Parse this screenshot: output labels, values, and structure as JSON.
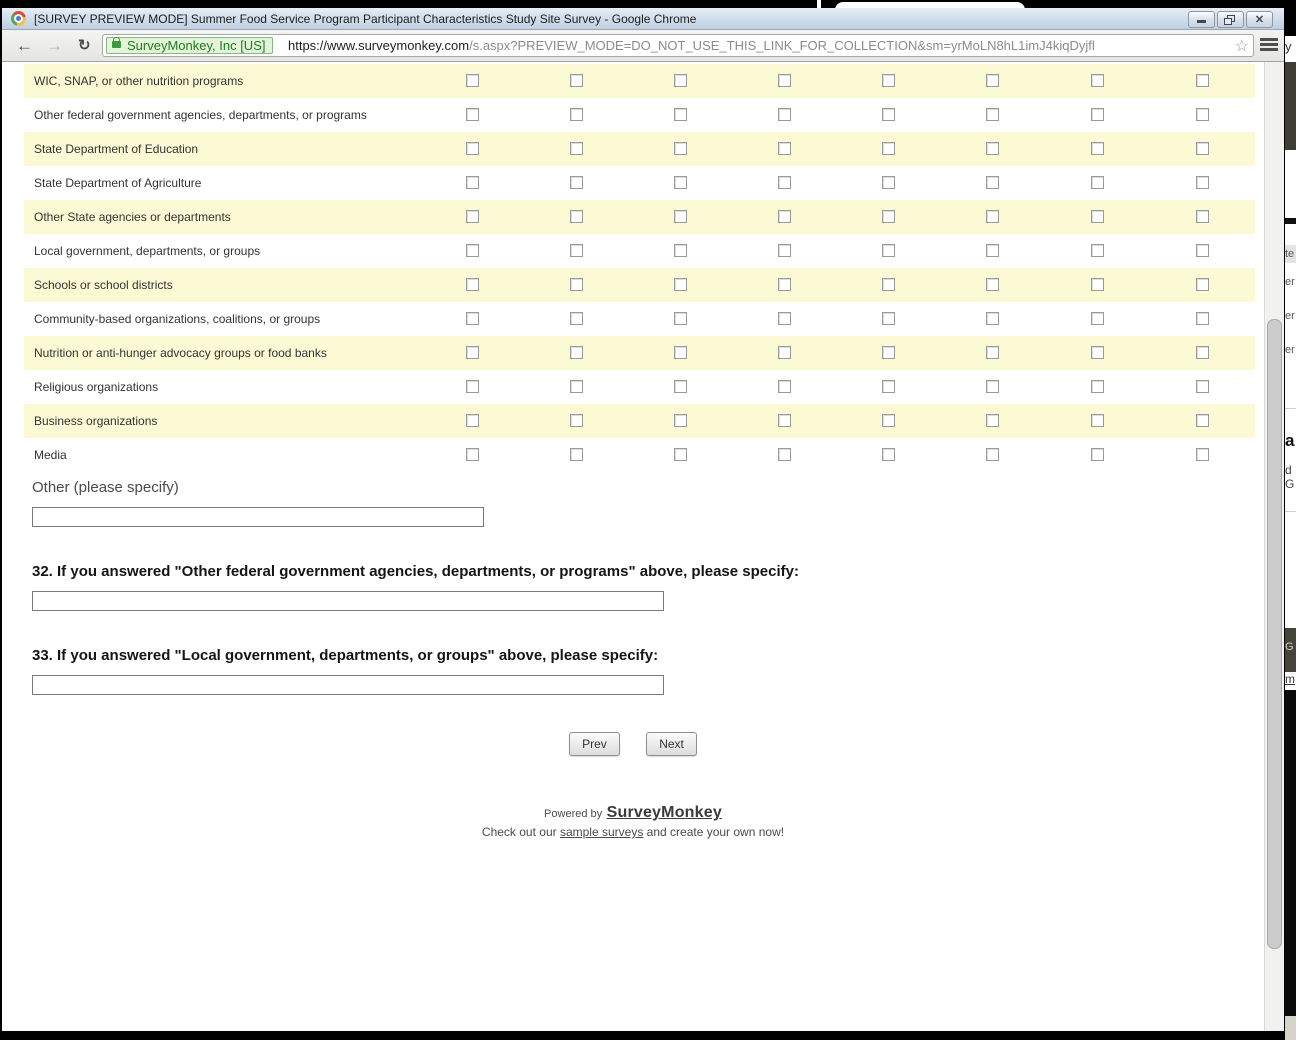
{
  "window": {
    "title": "[SURVEY PREVIEW MODE] Summer Food Service Program Participant Characteristics Study Site Survey - Google Chrome"
  },
  "browser": {
    "badge": "SurveyMonkey, Inc [US]",
    "url_host": "https://www.surveymonkey.com",
    "url_rest": "/s.aspx?PREVIEW_MODE=DO_NOT_USE_THIS_LINK_FOR_COLLECTION&sm=yrMoLN8hL1imJ4kiqDyjfl",
    "star_icon": "☆",
    "back_glyph": "←",
    "forward_glyph": "→",
    "reload_glyph": "↻"
  },
  "survey": {
    "matrix_rows": [
      "WIC, SNAP, or other nutrition programs",
      "Other federal government agencies, departments, or programs",
      "State Department of Education",
      "State Department of Agriculture",
      "Other State agencies or departments",
      "Local government, departments, or groups",
      "Schools or school districts",
      "Community-based organizations, coalitions, or groups",
      "Nutrition or anti-hunger advocacy groups or food banks",
      "Religious organizations",
      "Business organizations",
      "Media"
    ],
    "columns_count": 8,
    "other_label": "Other (please specify)",
    "q32_label": "32. If you answered \"Other federal government agencies, departments, or programs\" above, please specify:",
    "q33_label": "33. If you answered \"Local government, departments, or groups\" above, please specify:",
    "inputs": {
      "other_value": "",
      "q32_value": "",
      "q33_value": ""
    },
    "prev_label": "Prev",
    "next_label": "Next",
    "footer": {
      "powered_by": "Powered by",
      "brand": "SurveyMonkey",
      "line2_pre": "Check out our ",
      "line2_link": "sample surveys",
      "line2_post": " and create your own now!"
    }
  },
  "background_window_fragments": {
    "top": "y",
    "header": "te",
    "row1": "er",
    "row2": "er",
    "row3": "er",
    "big_a": "a",
    "frag_d": "d",
    "frag_g": "G",
    "olive_g": "G",
    "frag_m": "m"
  },
  "colors": {
    "row_highlight": "#fbfad5",
    "badge_green_text": "#1e7d1e",
    "badge_green_bg": "#e4f3da",
    "titlebar_blue": "#cfdcea"
  }
}
